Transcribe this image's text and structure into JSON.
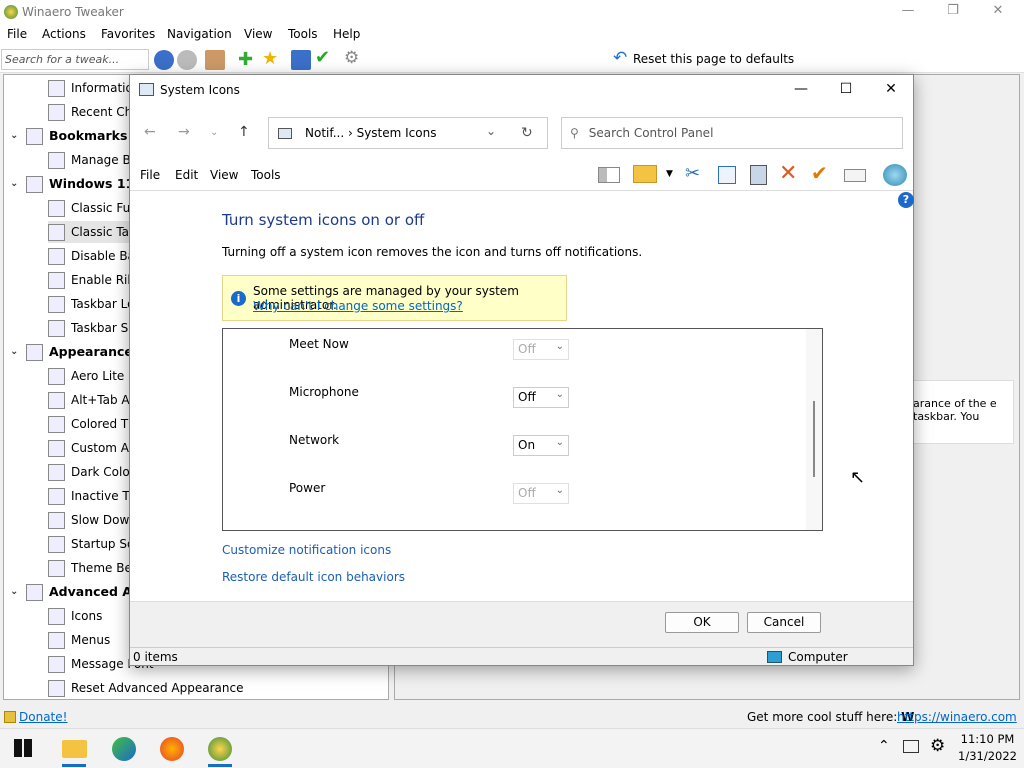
{
  "app": {
    "title": "Winaero Tweaker"
  },
  "menubar": [
    "File",
    "Actions",
    "Favorites",
    "Navigation",
    "View",
    "Tools",
    "Help"
  ],
  "toolbar": {
    "search_placeholder": "Search for a tweak...",
    "reset_label": "Reset this page to defaults"
  },
  "tree": [
    {
      "label": "Information",
      "level": 2
    },
    {
      "label": "Recent Char",
      "level": 2
    },
    {
      "label": "Bookmarks",
      "level": 1
    },
    {
      "label": "Manage Boo",
      "level": 2
    },
    {
      "label": "Windows 11",
      "level": 1
    },
    {
      "label": "Classic Full C",
      "level": 2
    },
    {
      "label": "Classic Task",
      "level": 2,
      "selected": true
    },
    {
      "label": "Disable Back",
      "level": 2
    },
    {
      "label": "Enable Ribb",
      "level": 2
    },
    {
      "label": "Taskbar Loc",
      "level": 2
    },
    {
      "label": "Taskbar Size",
      "level": 2
    },
    {
      "label": "Appearance",
      "level": 1
    },
    {
      "label": "Aero Lite",
      "level": 2
    },
    {
      "label": "Alt+Tab App",
      "level": 2
    },
    {
      "label": "Colored Title",
      "level": 2
    },
    {
      "label": "Custom Acce",
      "level": 2
    },
    {
      "label": "Dark Color S",
      "level": 2
    },
    {
      "label": "Inactive Title",
      "level": 2
    },
    {
      "label": "Slow Down A",
      "level": 2
    },
    {
      "label": "Startup Soun",
      "level": 2
    },
    {
      "label": "Theme Beha",
      "level": 2
    },
    {
      "label": "Advanced App",
      "level": 1
    },
    {
      "label": "Icons",
      "level": 2
    },
    {
      "label": "Menus",
      "level": 2
    },
    {
      "label": "Message Font",
      "level": 2
    },
    {
      "label": "Reset Advanced Appearance",
      "level": 2
    }
  ],
  "description": "arance of the e taskbar. You",
  "statusbar": {
    "donate": "Donate!",
    "getmore": "Get more cool stuff here:",
    "wlogo": "W",
    "link": "https://winaero.com"
  },
  "dialog": {
    "title": "System Icons",
    "breadcrumb": "Notif...  ›  System Icons",
    "search_placeholder": "Search Control Panel",
    "menus": [
      "File",
      "Edit",
      "View",
      "Tools"
    ],
    "heading": "Turn system icons on or off",
    "subtext": "Turning off a system icon removes the icon and turns off notifications.",
    "notice_line1": "Some settings are managed by your system administrator.",
    "notice_link": "Why can't I change some settings?",
    "icons": [
      {
        "name": "Meet Now",
        "value": "Off",
        "disabled": true
      },
      {
        "name": "Microphone",
        "value": "Off",
        "disabled": false
      },
      {
        "name": "Network",
        "value": "On",
        "disabled": false
      },
      {
        "name": "Power",
        "value": "Off",
        "disabled": true
      }
    ],
    "link1": "Customize notification icons",
    "link2": "Restore default icon behaviors",
    "ok": "OK",
    "cancel": "Cancel",
    "status_items": "0 items",
    "status_computer": "Computer"
  },
  "taskbar": {
    "time": "11:10 PM",
    "date": "1/31/2022"
  }
}
